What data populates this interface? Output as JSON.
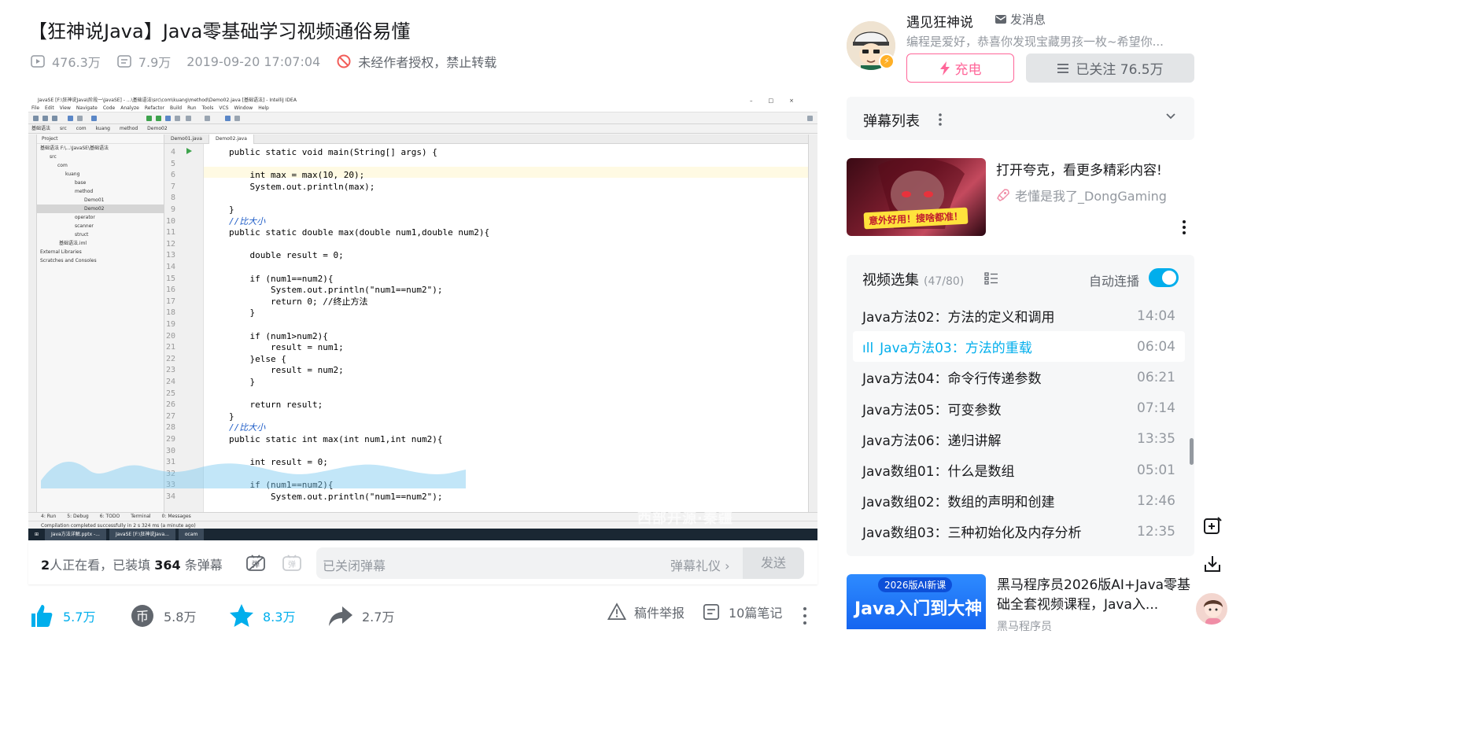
{
  "video": {
    "title": "【狂神说Java】Java零基础学习视频通俗易懂",
    "views": "476.3万",
    "danmaku_count": "7.9万",
    "date": "2019-09-20 17:07:04",
    "copyright": "未经作者授权，禁止转载"
  },
  "ide": {
    "window_title": "JavaSE [F:\\狂神说Java\\阶段一\\JavaSE] - ...\\基础语法\\src\\com\\kuang\\method\\Demo02.java [基础语法] - IntelliJ IDEA",
    "menu": [
      "File",
      "Edit",
      "View",
      "Navigate",
      "Code",
      "Analyze",
      "Refactor",
      "Build",
      "Run",
      "Tools",
      "VCS",
      "Window",
      "Help"
    ],
    "breadcrumbs": [
      "基础语法",
      "src",
      "com",
      "kuang",
      "method",
      "Demo02"
    ],
    "project_header": "Project",
    "tree": [
      "基础语法  F:\\...\\JavaSE\\基础语法",
      "src",
      "com",
      "kuang",
      "base",
      "method",
      "Demo01",
      "Demo02",
      "operator",
      "scanner",
      "struct",
      "基础语法.iml",
      "External Libraries",
      "Scratches and Consoles"
    ],
    "tabs": [
      "Demo01.java",
      "Demo02.java"
    ],
    "code": [
      {
        "n": "4",
        "t": "public static void main(String[] args) {"
      },
      {
        "n": "5",
        "t": ""
      },
      {
        "n": "6",
        "t": "    int max = max(10, 20);"
      },
      {
        "n": "7",
        "t": "    System.out.println(max);"
      },
      {
        "n": "8",
        "t": ""
      },
      {
        "n": "9",
        "t": "}"
      },
      {
        "n": "10",
        "t": "//比大小"
      },
      {
        "n": "11",
        "t": "public static double max(double num1,double num2){"
      },
      {
        "n": "12",
        "t": ""
      },
      {
        "n": "13",
        "t": "    double result = 0;"
      },
      {
        "n": "14",
        "t": ""
      },
      {
        "n": "15",
        "t": "    if (num1==num2){"
      },
      {
        "n": "16",
        "t": "        System.out.println(\"num1==num2\");"
      },
      {
        "n": "17",
        "t": "        return 0; //终止方法"
      },
      {
        "n": "18",
        "t": "    }"
      },
      {
        "n": "19",
        "t": ""
      },
      {
        "n": "20",
        "t": "    if (num1>num2){"
      },
      {
        "n": "21",
        "t": "        result = num1;"
      },
      {
        "n": "22",
        "t": "    }else {"
      },
      {
        "n": "23",
        "t": "        result = num2;"
      },
      {
        "n": "24",
        "t": "    }"
      },
      {
        "n": "25",
        "t": ""
      },
      {
        "n": "26",
        "t": "    return result;"
      },
      {
        "n": "27",
        "t": "}"
      },
      {
        "n": "28",
        "t": "//比大小"
      },
      {
        "n": "29",
        "t": "public static int max(int num1,int num2){"
      },
      {
        "n": "30",
        "t": ""
      },
      {
        "n": "31",
        "t": "    int result = 0;"
      },
      {
        "n": "32",
        "t": ""
      },
      {
        "n": "33",
        "t": "    if (num1==num2){"
      },
      {
        "n": "34",
        "t": "        System.out.println(\"num1==num2\");"
      }
    ],
    "bottom_tools": [
      "4: Run",
      "5: Debug",
      "6: TODO",
      "Terminal",
      "0: Messages"
    ],
    "status_text": "Compilation completed successfully in 2 s 324 ms (a minute ago)",
    "taskbar_apps": [
      "Java方法详解.pptx -...",
      "JavaSE [F:\\狂神说Java...",
      "ocam"
    ],
    "watermark": "西部开源·秦疆"
  },
  "danmaku_bar": {
    "viewers": "2",
    "viewers_suffix": "人正在看，已装填 ",
    "loaded": "364",
    "loaded_suffix": " 条弹幕",
    "placeholder": "已关闭弹幕",
    "etiquette": "弹幕礼仪 ›",
    "send": "发送"
  },
  "actions": {
    "like": "5.7万",
    "coin": "5.8万",
    "favorite": "8.3万",
    "share": "2.7万",
    "report": "稿件举报",
    "notes": "10篇笔记"
  },
  "uploader": {
    "name": "遇见狂神说",
    "message": "发消息",
    "description": "编程是爱好，恭喜你发现宝藏男孩一枚~希望你...",
    "charge": "充电",
    "follow": "已关注 76.5万"
  },
  "danmaku_list": {
    "label": "弹幕列表"
  },
  "ad": {
    "image_text": "意外好用！搜啥都准！",
    "title": "打开夸克，看更多精彩内容!",
    "author": "老懂是我了_DongGaming"
  },
  "playlist": {
    "title": "视频选集",
    "progress": "(47/80)",
    "autoplay": "自动连播",
    "autoplay_on": true,
    "items": [
      {
        "title": "Java方法02：方法的定义和调用",
        "dur": "14:04",
        "active": false
      },
      {
        "title": "Java方法03：方法的重载",
        "dur": "06:04",
        "active": true
      },
      {
        "title": "Java方法04：命令行传递参数",
        "dur": "06:21",
        "active": false
      },
      {
        "title": "Java方法05：可变参数",
        "dur": "07:14",
        "active": false
      },
      {
        "title": "Java方法06：递归讲解",
        "dur": "13:35",
        "active": false
      },
      {
        "title": "Java数组01：什么是数组",
        "dur": "05:01",
        "active": false
      },
      {
        "title": "Java数组02：数组的声明和创建",
        "dur": "12:46",
        "active": false
      },
      {
        "title": "Java数组03：三种初始化及内存分析",
        "dur": "12:35",
        "active": false
      }
    ]
  },
  "recommend": {
    "thumb_badge": "2026版AI新课",
    "thumb_title": "Java入门到大神",
    "title": "黑马程序员2026版AI+Java零基础全套视频课程，Java入...",
    "author": "黑马程序员"
  },
  "colors": {
    "accent": "#00aeec",
    "charge": "#ff6699",
    "text_primary": "#18191c",
    "text_secondary": "#9499a0"
  }
}
